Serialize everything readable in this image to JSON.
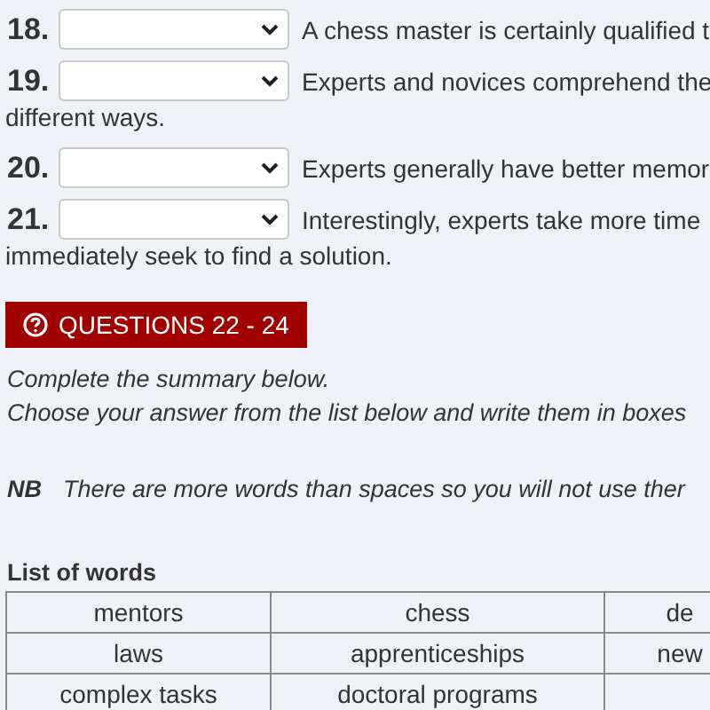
{
  "questions": [
    {
      "number": "18.",
      "text": "A chess master is certainly qualified t"
    },
    {
      "number": "19.",
      "text": "Experts and novices comprehend the",
      "continuation": "different ways."
    },
    {
      "number": "20.",
      "text": "Experts generally have better memor"
    },
    {
      "number": "21.",
      "text": "Interestingly, experts take more time",
      "continuation": "immediately seek to find a solution."
    }
  ],
  "section": {
    "title": "QUESTIONS 22 - 24",
    "instructions": [
      "Complete the summary below.",
      "Choose your answer from the list below and write them in boxes"
    ],
    "nb_label": "NB",
    "nb_text": "There are more words than spaces so you will not use ther"
  },
  "word_list": {
    "title": "List of words",
    "rows": [
      [
        "mentors",
        "chess",
        "de"
      ],
      [
        "laws",
        "apprenticeships",
        "new"
      ],
      [
        "complex tasks",
        "doctoral programs",
        ""
      ]
    ]
  }
}
